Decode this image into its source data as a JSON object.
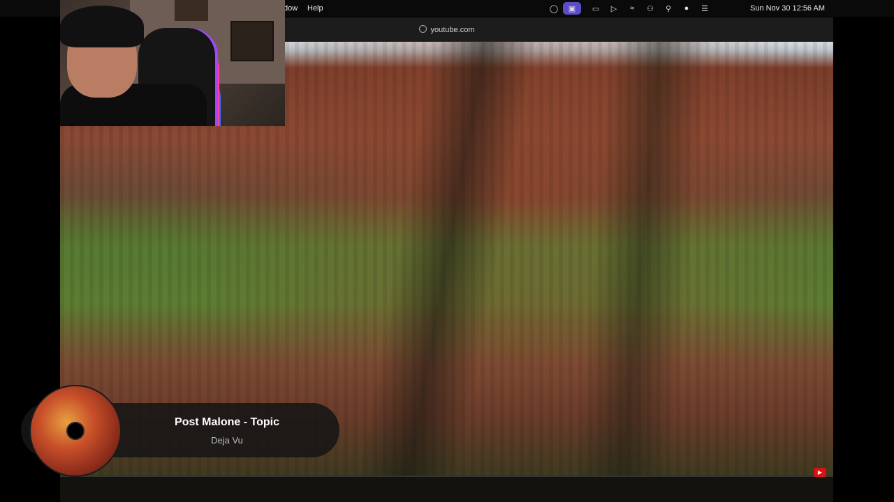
{
  "menubar": {
    "items": [
      "dow",
      "Help"
    ],
    "clock": "Sun Nov 30  12:56 AM"
  },
  "browser": {
    "url": "youtube.com"
  },
  "now_playing": {
    "artist": "Post Malone - Topic",
    "track": "Deja Vu"
  }
}
